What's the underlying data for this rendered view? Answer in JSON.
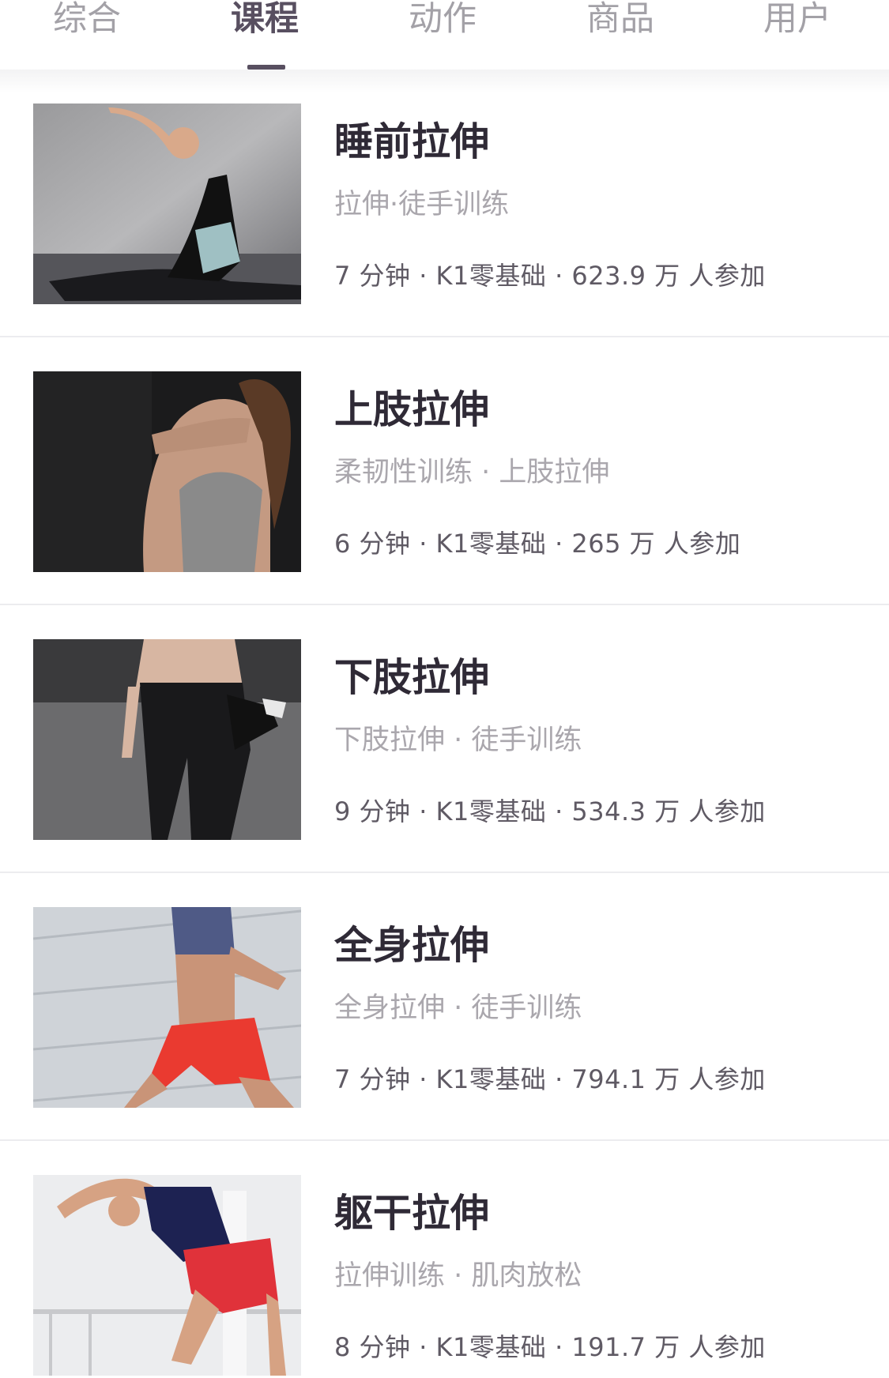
{
  "tabs": [
    {
      "label": "综合",
      "active": false
    },
    {
      "label": "课程",
      "active": true
    },
    {
      "label": "动作",
      "active": false
    },
    {
      "label": "商品",
      "active": false
    },
    {
      "label": "用户",
      "active": false
    }
  ],
  "courses": [
    {
      "title": "睡前拉伸",
      "tags": "拉伸·徒手训练",
      "meta": "7 分钟 · K1零基础 · 623.9 万 人参加",
      "image": "woman-yoga-split-photo"
    },
    {
      "title": "上肢拉伸",
      "tags": "柔韧性训练 · 上肢拉伸",
      "meta": "6 分钟 · K1零基础 · 265 万 人参加",
      "image": "woman-arm-stretch-photo"
    },
    {
      "title": "下肢拉伸",
      "tags": "下肢拉伸 · 徒手训练",
      "meta": "9 分钟 · K1零基础 · 534.3 万 人参加",
      "image": "woman-quad-stretch-photo"
    },
    {
      "title": "全身拉伸",
      "tags": "全身拉伸 · 徒手训练",
      "meta": "7 分钟 · K1零基础 · 794.1 万 人参加",
      "image": "woman-lunge-stretch-photo"
    },
    {
      "title": "躯干拉伸",
      "tags": "拉伸训练 · 肌肉放松",
      "meta": "8 分钟 · K1零基础 · 191.7 万 人参加",
      "image": "man-side-stretch-photo"
    }
  ],
  "colors": {
    "tab_active": "#584f60",
    "tab_inactive": "#a3a1a7",
    "title": "#2f2a36",
    "tags": "#aaa7ad",
    "meta": "#5f5a64",
    "divider": "#ececef"
  }
}
